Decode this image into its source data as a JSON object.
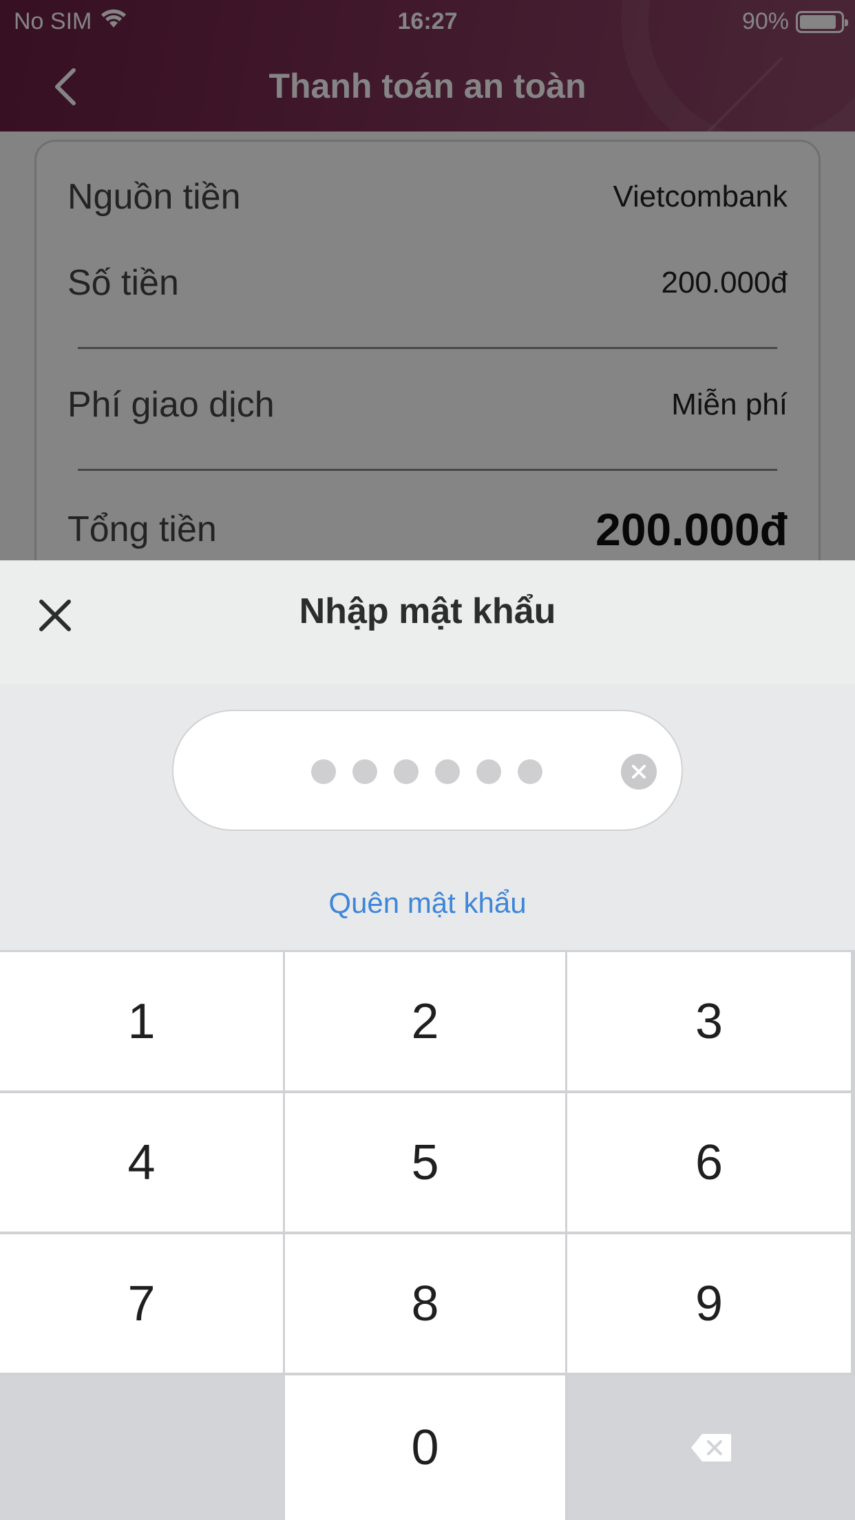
{
  "status_bar": {
    "carrier": "No SIM",
    "time": "16:27",
    "battery": "90%",
    "battery_level": 0.9
  },
  "nav": {
    "title": "Thanh toán an toàn"
  },
  "payment": {
    "source_label": "Nguồn tiền",
    "source_value": "Vietcombank",
    "amount_label": "Số tiền",
    "amount_value": "200.000đ",
    "fee_label": "Phí giao dịch",
    "fee_value": "Miễn phí",
    "total_label": "Tổng tiền",
    "total_value": "200.000đ"
  },
  "sheet": {
    "title": "Nhập mật khẩu",
    "forgot_link": "Quên mật khẩu",
    "pin_length": 6
  },
  "keypad": {
    "keys": [
      "1",
      "2",
      "3",
      "4",
      "5",
      "6",
      "7",
      "8",
      "9",
      "0"
    ]
  },
  "colors": {
    "header": "#6a1f44",
    "link": "#3d86d8"
  }
}
